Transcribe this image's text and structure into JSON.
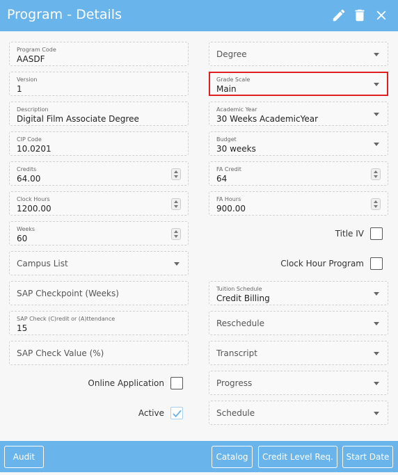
{
  "header": {
    "title": "Program - Details",
    "icons": [
      "pencil-icon",
      "trash-icon",
      "close-icon"
    ],
    "color": "#6ab4ec"
  },
  "left": {
    "program_code": {
      "label": "Program Code",
      "value": "AASDF"
    },
    "version": {
      "label": "Version",
      "value": "1"
    },
    "description": {
      "label": "Description",
      "value": "Digital Film Associate Degree"
    },
    "cip_code": {
      "label": "CIP Code",
      "value": "10.0201"
    },
    "credits": {
      "label": "Credits",
      "value": "64.00"
    },
    "clock_hours": {
      "label": "Clock Hours",
      "value": "1200.00"
    },
    "weeks": {
      "label": "Weeks",
      "value": "60"
    },
    "campus_list": {
      "placeholder": "Campus List"
    },
    "sap_checkpoint": {
      "placeholder": "SAP Checkpoint (Weeks)"
    },
    "sap_check_type": {
      "label": "SAP Check (C)redit or (A)ttendance",
      "value": "15"
    },
    "sap_check_value": {
      "placeholder": "SAP Check Value (%)"
    },
    "online_application": {
      "label": "Online Application",
      "checked": false
    },
    "active": {
      "label": "Active",
      "checked": true
    }
  },
  "right": {
    "degree": {
      "placeholder": "Degree"
    },
    "grade_scale": {
      "label": "Grade Scale",
      "value": "Main"
    },
    "academic_year": {
      "label": "Academic Year",
      "value": "30 Weeks AcademicYear"
    },
    "budget": {
      "label": "Budget",
      "value": "30 weeks"
    },
    "fa_credit": {
      "label": "FA Credit",
      "value": "64"
    },
    "fa_hours": {
      "label": "FA Hours",
      "value": "900.00"
    },
    "title_iv": {
      "label": "Title IV",
      "checked": false
    },
    "clock_hour_program": {
      "label": "Clock Hour Program",
      "checked": false
    },
    "tuition_schedule": {
      "label": "Tuition Schedule",
      "value": "Credit Billing"
    },
    "reschedule": {
      "placeholder": "Reschedule"
    },
    "transcript": {
      "placeholder": "Transcript"
    },
    "progress": {
      "placeholder": "Progress"
    },
    "schedule": {
      "placeholder": "Schedule"
    }
  },
  "footer": {
    "audit": "Audit",
    "catalog": "Catalog",
    "credit_level_req": "Credit Level Req.",
    "start_date": "Start Date"
  },
  "colors": {
    "highlight": "#e02020",
    "check": "#6ab4ec"
  }
}
